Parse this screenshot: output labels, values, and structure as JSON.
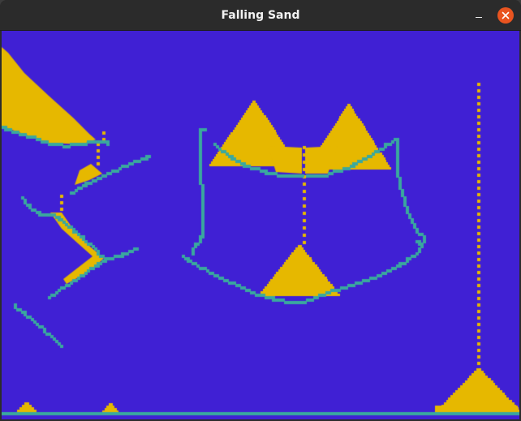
{
  "window": {
    "title": "Falling Sand"
  },
  "colors": {
    "background": "#4020d4",
    "sand": "#e6b800",
    "wall": "#3aa89e",
    "titlebar": "#2b2b2b",
    "close": "#e95420"
  },
  "icons": {
    "minimize": "minimize-icon",
    "close": "close-icon"
  }
}
